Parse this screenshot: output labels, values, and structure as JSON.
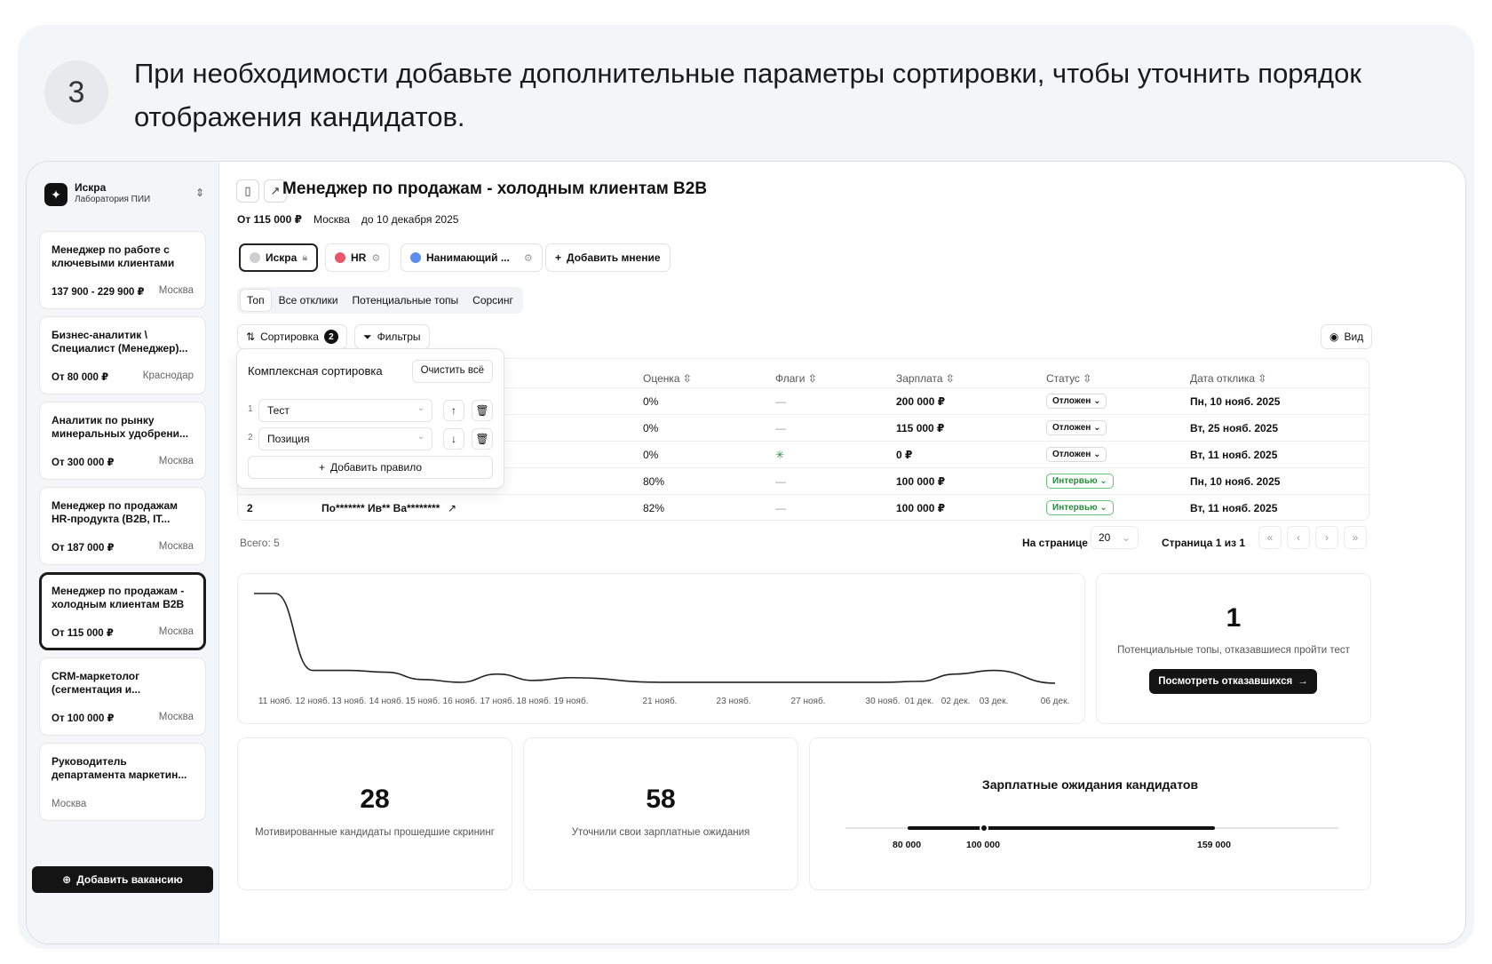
{
  "step": {
    "number": "3",
    "text": "При необходимости добавьте дополнительные параметры сортировки, чтобы уточнить порядок отображения кандидатов."
  },
  "org": {
    "name": "Искра",
    "subtitle": "Лаборатория ПИИ"
  },
  "vacancies": [
    {
      "title": "Менеджер по работе с ключевыми клиентами",
      "salary": "137 900 - 229 900 ₽",
      "city": "Москва"
    },
    {
      "title": "Бизнес-аналитик \\ Специалист (Менеджер)...",
      "salary": "От 80 000 ₽",
      "city": "Краснодар"
    },
    {
      "title": "Аналитик по рынку минеральных удобрени...",
      "salary": "От 300 000 ₽",
      "city": "Москва"
    },
    {
      "title": "Менеджер по продажам HR-продукта (B2B, IT...",
      "salary": "От 187 000 ₽",
      "city": "Москва"
    },
    {
      "title": "Менеджер по продажам - холодным клиентам B2B",
      "salary": "От 115 000 ₽",
      "city": "Москва"
    },
    {
      "title": "CRM-маркетолог (сегментация и...",
      "salary": "От 100 000 ₽",
      "city": "Москва"
    },
    {
      "title": "Руководитель департамента маркетин...",
      "salary": "",
      "city": "Москва"
    }
  ],
  "add_vacancy": "Добавить вакансию",
  "header": {
    "title": "Менеджер по продажам - холодным клиентам B2B",
    "salary": "От 115 000 ₽",
    "city": "Москва",
    "deadline": "до 10 декабря 2025"
  },
  "opinions": {
    "iskra": "Искра",
    "hr": "HR",
    "hiring": "Нанимающий ...",
    "add": "Добавить мнение"
  },
  "tabs": [
    "Топ",
    "Все отклики",
    "Потенциальные топы",
    "Сорсинг"
  ],
  "toolbar": {
    "sort": "Сортировка",
    "sort_count": "2",
    "filters": "Фильтры",
    "view": "Вид"
  },
  "table": {
    "headers": {
      "score": "Оценка",
      "flags": "Флаги",
      "salary": "Зарплата",
      "status": "Статус",
      "date": "Дата отклика"
    },
    "rows": [
      {
        "num": "",
        "name": "",
        "score": "0%",
        "flag": "—",
        "salary": "200 000 ₽",
        "status": "Отложен",
        "date": "Пн, 10 нояб. 2025"
      },
      {
        "num": "",
        "name": "",
        "score": "0%",
        "flag": "—",
        "salary": "115 000 ₽",
        "status": "Отложен",
        "date": "Вт, 25 нояб. 2025"
      },
      {
        "num": "",
        "name": "",
        "score": "0%",
        "flag": "",
        "salary": "0 ₽",
        "status": "Отложен",
        "date": "Вт, 11 нояб. 2025"
      },
      {
        "num": "",
        "name": "",
        "score": "80%",
        "flag": "—",
        "salary": "100 000 ₽",
        "status": "Интервью",
        "date": "Пн, 10 нояб. 2025"
      },
      {
        "num": "2",
        "name": "По******* Ив** Ва********",
        "score": "82%",
        "flag": "—",
        "salary": "100 000 ₽",
        "status": "Интервью",
        "date": "Вт, 11 нояб. 2025"
      }
    ]
  },
  "sort_popover": {
    "title": "Комплексная сортировка",
    "clear": "Очистить всё",
    "rules": [
      {
        "n": "1",
        "field": "Тест",
        "dir": "↑"
      },
      {
        "n": "2",
        "field": "Позиция",
        "dir": "↓"
      }
    ],
    "add_rule": "Добавить правило"
  },
  "pagination": {
    "total": "Всего: 5",
    "per_page_label": "На странице",
    "per_page": "20",
    "page": "Страница 1 из 1"
  },
  "chart_data": {
    "type": "line",
    "x": [
      "11 нояб.",
      "12 нояб.",
      "13 нояб.",
      "14 нояб.",
      "15 нояб.",
      "16 нояб.",
      "17 нояб.",
      "18 нояб.",
      "19 нояб.",
      "21 нояб.",
      "23 нояб.",
      "27 нояб.",
      "30 нояб.",
      "01 дек.",
      "02 дек.",
      "03 дек.",
      "06 дек."
    ],
    "y": [
      10,
      1.6,
      1.6,
      1.4,
      0.6,
      0.3,
      1.2,
      0.5,
      0.8,
      0.3,
      0.3,
      0.3,
      0.3,
      0.4,
      1.2,
      1.6,
      0.2
    ],
    "grid": false
  },
  "stat_refused": {
    "value": "1",
    "caption": "Потенциальные топы, отказавшиеся пройти тест",
    "button": "Посмотреть отказавшихся"
  },
  "stat_motivated": {
    "value": "28",
    "caption": "Мотивированные кандидаты прошедшие скрининг"
  },
  "stat_salary_clarified": {
    "value": "58",
    "caption": "Уточнили свои зарплатные ожидания"
  },
  "salary_expect": {
    "title": "Зарплатные ожидания кандидатов",
    "min": "80 000",
    "median": "100 000",
    "max": "159 000",
    "min_v": 80000,
    "median_v": 100000,
    "max_v": 159000
  },
  "colors": {
    "hr": "#e9566a",
    "hiring": "#5b8def",
    "iskra": "#cfcfd3",
    "interview": "#2b8a3e"
  }
}
